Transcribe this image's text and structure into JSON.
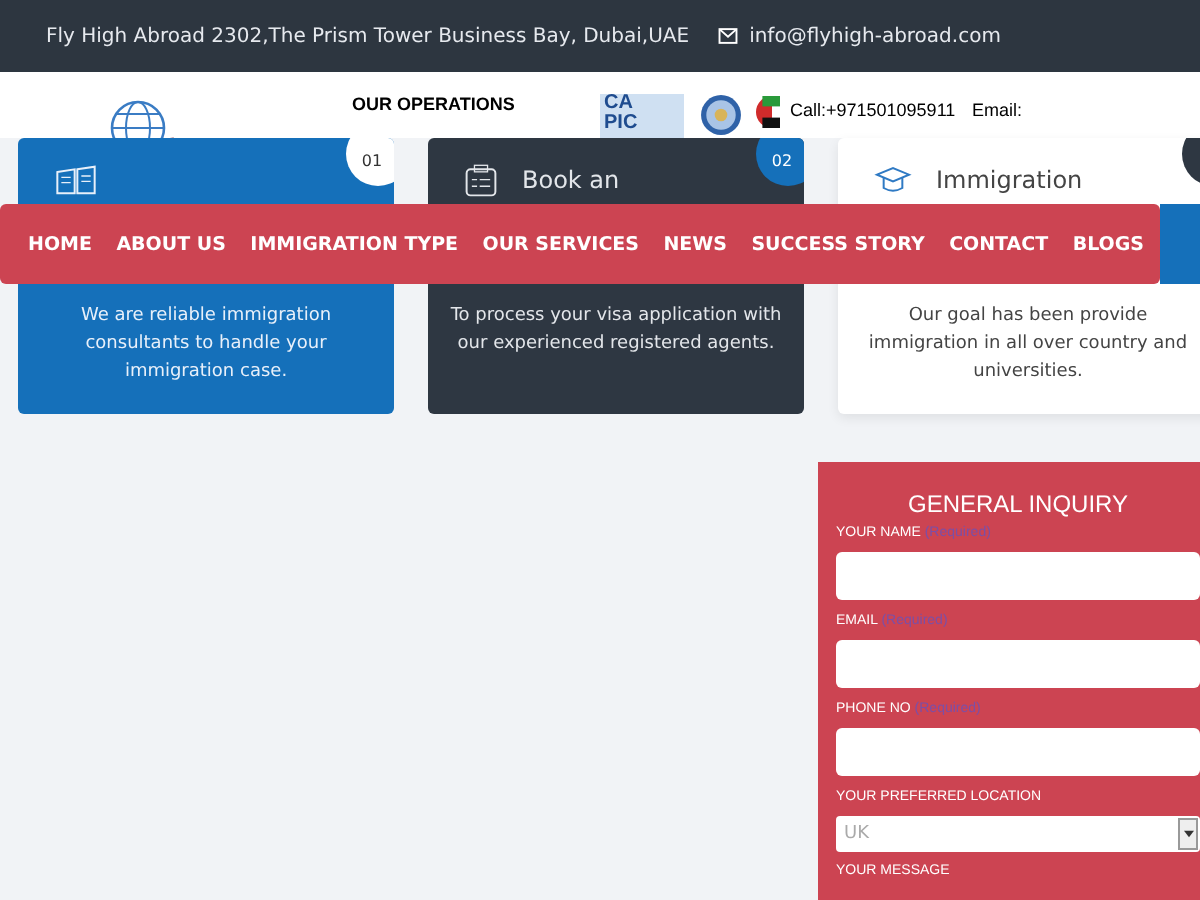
{
  "top_bar": {
    "address": "Fly High Abroad 2302,The Prism Tower Business Bay, Dubai,UAE",
    "email": "info@flyhigh-abroad.com"
  },
  "header": {
    "operations_heading": "OUR OPERATIONS",
    "partner_logo": [
      "CA",
      "PIC"
    ],
    "call": "Call:+971501095911",
    "email_label": "Email:"
  },
  "cards": [
    {
      "kind": "blue",
      "number": "01",
      "text": "We are reliable immigration consultants to handle your immigration case."
    },
    {
      "kind": "dark",
      "number": "02",
      "title": "Book an",
      "text": "To process your visa application with our experienced registered agents."
    },
    {
      "kind": "light",
      "title": "Immigration",
      "text": "Our goal has been provide immigration in all over country and universities."
    }
  ],
  "nav": [
    {
      "label": "HOME"
    },
    {
      "label": "ABOUT US"
    },
    {
      "label": "IMMIGRATION TYPE"
    },
    {
      "label": "OUR SERVICES"
    },
    {
      "label": "NEWS"
    },
    {
      "label": "SUCCESS STORY"
    },
    {
      "label": "CONTACT"
    },
    {
      "label": "BLOGS"
    }
  ],
  "form": {
    "title": "GENERAL INQUIRY",
    "fields": [
      {
        "kind": "text",
        "label": "YOUR NAME",
        "note": "(Required)"
      },
      {
        "kind": "text",
        "label": "EMAIL",
        "note": "(Required)"
      },
      {
        "kind": "text",
        "label": "PHONE NO",
        "note": "(Required)"
      },
      {
        "kind": "select",
        "label": "YOUR PREFERRED LOCATION",
        "value": "UK"
      },
      {
        "kind": "label",
        "label": "YOUR MESSAGE"
      }
    ]
  }
}
